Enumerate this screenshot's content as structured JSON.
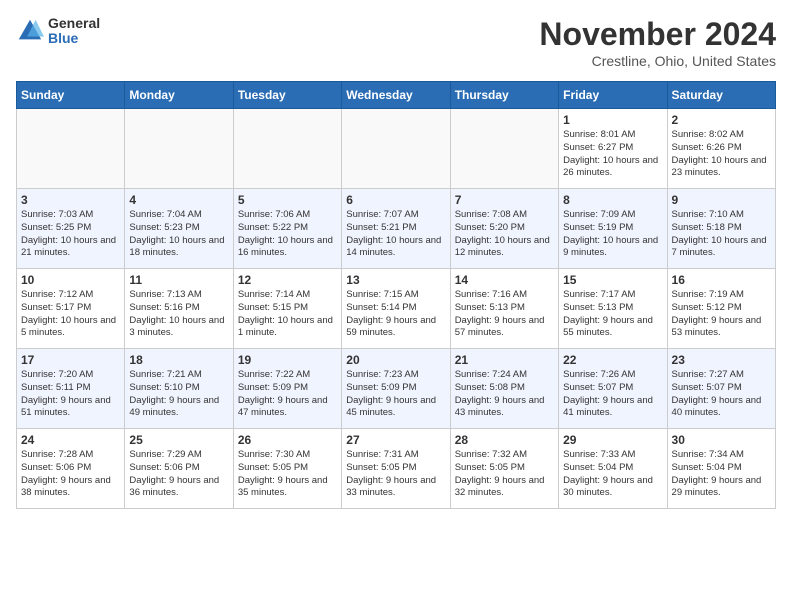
{
  "header": {
    "logo_general": "General",
    "logo_blue": "Blue",
    "month": "November 2024",
    "location": "Crestline, Ohio, United States"
  },
  "weekdays": [
    "Sunday",
    "Monday",
    "Tuesday",
    "Wednesday",
    "Thursday",
    "Friday",
    "Saturday"
  ],
  "weeks": [
    [
      {
        "day": "",
        "info": ""
      },
      {
        "day": "",
        "info": ""
      },
      {
        "day": "",
        "info": ""
      },
      {
        "day": "",
        "info": ""
      },
      {
        "day": "",
        "info": ""
      },
      {
        "day": "1",
        "info": "Sunrise: 8:01 AM\nSunset: 6:27 PM\nDaylight: 10 hours and 26 minutes."
      },
      {
        "day": "2",
        "info": "Sunrise: 8:02 AM\nSunset: 6:26 PM\nDaylight: 10 hours and 23 minutes."
      }
    ],
    [
      {
        "day": "3",
        "info": "Sunrise: 7:03 AM\nSunset: 5:25 PM\nDaylight: 10 hours and 21 minutes."
      },
      {
        "day": "4",
        "info": "Sunrise: 7:04 AM\nSunset: 5:23 PM\nDaylight: 10 hours and 18 minutes."
      },
      {
        "day": "5",
        "info": "Sunrise: 7:06 AM\nSunset: 5:22 PM\nDaylight: 10 hours and 16 minutes."
      },
      {
        "day": "6",
        "info": "Sunrise: 7:07 AM\nSunset: 5:21 PM\nDaylight: 10 hours and 14 minutes."
      },
      {
        "day": "7",
        "info": "Sunrise: 7:08 AM\nSunset: 5:20 PM\nDaylight: 10 hours and 12 minutes."
      },
      {
        "day": "8",
        "info": "Sunrise: 7:09 AM\nSunset: 5:19 PM\nDaylight: 10 hours and 9 minutes."
      },
      {
        "day": "9",
        "info": "Sunrise: 7:10 AM\nSunset: 5:18 PM\nDaylight: 10 hours and 7 minutes."
      }
    ],
    [
      {
        "day": "10",
        "info": "Sunrise: 7:12 AM\nSunset: 5:17 PM\nDaylight: 10 hours and 5 minutes."
      },
      {
        "day": "11",
        "info": "Sunrise: 7:13 AM\nSunset: 5:16 PM\nDaylight: 10 hours and 3 minutes."
      },
      {
        "day": "12",
        "info": "Sunrise: 7:14 AM\nSunset: 5:15 PM\nDaylight: 10 hours and 1 minute."
      },
      {
        "day": "13",
        "info": "Sunrise: 7:15 AM\nSunset: 5:14 PM\nDaylight: 9 hours and 59 minutes."
      },
      {
        "day": "14",
        "info": "Sunrise: 7:16 AM\nSunset: 5:13 PM\nDaylight: 9 hours and 57 minutes."
      },
      {
        "day": "15",
        "info": "Sunrise: 7:17 AM\nSunset: 5:13 PM\nDaylight: 9 hours and 55 minutes."
      },
      {
        "day": "16",
        "info": "Sunrise: 7:19 AM\nSunset: 5:12 PM\nDaylight: 9 hours and 53 minutes."
      }
    ],
    [
      {
        "day": "17",
        "info": "Sunrise: 7:20 AM\nSunset: 5:11 PM\nDaylight: 9 hours and 51 minutes."
      },
      {
        "day": "18",
        "info": "Sunrise: 7:21 AM\nSunset: 5:10 PM\nDaylight: 9 hours and 49 minutes."
      },
      {
        "day": "19",
        "info": "Sunrise: 7:22 AM\nSunset: 5:09 PM\nDaylight: 9 hours and 47 minutes."
      },
      {
        "day": "20",
        "info": "Sunrise: 7:23 AM\nSunset: 5:09 PM\nDaylight: 9 hours and 45 minutes."
      },
      {
        "day": "21",
        "info": "Sunrise: 7:24 AM\nSunset: 5:08 PM\nDaylight: 9 hours and 43 minutes."
      },
      {
        "day": "22",
        "info": "Sunrise: 7:26 AM\nSunset: 5:07 PM\nDaylight: 9 hours and 41 minutes."
      },
      {
        "day": "23",
        "info": "Sunrise: 7:27 AM\nSunset: 5:07 PM\nDaylight: 9 hours and 40 minutes."
      }
    ],
    [
      {
        "day": "24",
        "info": "Sunrise: 7:28 AM\nSunset: 5:06 PM\nDaylight: 9 hours and 38 minutes."
      },
      {
        "day": "25",
        "info": "Sunrise: 7:29 AM\nSunset: 5:06 PM\nDaylight: 9 hours and 36 minutes."
      },
      {
        "day": "26",
        "info": "Sunrise: 7:30 AM\nSunset: 5:05 PM\nDaylight: 9 hours and 35 minutes."
      },
      {
        "day": "27",
        "info": "Sunrise: 7:31 AM\nSunset: 5:05 PM\nDaylight: 9 hours and 33 minutes."
      },
      {
        "day": "28",
        "info": "Sunrise: 7:32 AM\nSunset: 5:05 PM\nDaylight: 9 hours and 32 minutes."
      },
      {
        "day": "29",
        "info": "Sunrise: 7:33 AM\nSunset: 5:04 PM\nDaylight: 9 hours and 30 minutes."
      },
      {
        "day": "30",
        "info": "Sunrise: 7:34 AM\nSunset: 5:04 PM\nDaylight: 9 hours and 29 minutes."
      }
    ]
  ]
}
